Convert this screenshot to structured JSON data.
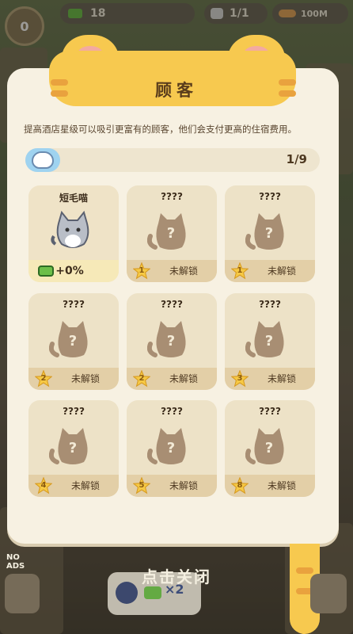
{
  "hud": {
    "star_level": "0",
    "money": "18",
    "guest_count": "1/1",
    "fish_count": "100M"
  },
  "modal": {
    "title": "顾客",
    "description": "提高酒店星级可以吸引更富有的顾客，他们会支付更高的住宿费用。",
    "progress": {
      "text": "1/9",
      "fraction": 0.111
    },
    "cards": [
      {
        "name": "短毛喵",
        "unlocked": true,
        "bonus": "+0%"
      },
      {
        "name": "????",
        "unlocked": false,
        "star": "1",
        "status": "未解锁"
      },
      {
        "name": "????",
        "unlocked": false,
        "star": "1",
        "status": "未解锁"
      },
      {
        "name": "????",
        "unlocked": false,
        "star": "2",
        "status": "未解锁"
      },
      {
        "name": "????",
        "unlocked": false,
        "star": "2",
        "status": "未解锁"
      },
      {
        "name": "????",
        "unlocked": false,
        "star": "3",
        "status": "未解锁"
      },
      {
        "name": "????",
        "unlocked": false,
        "star": "4",
        "status": "未解锁"
      },
      {
        "name": "????",
        "unlocked": false,
        "star": "5",
        "status": "未解锁"
      },
      {
        "name": "????",
        "unlocked": false,
        "star": "8",
        "status": "未解锁"
      }
    ]
  },
  "footer": {
    "close_label": "点击关闭",
    "ad_multiplier": "×2",
    "no_ads_label": "NO ADS"
  }
}
